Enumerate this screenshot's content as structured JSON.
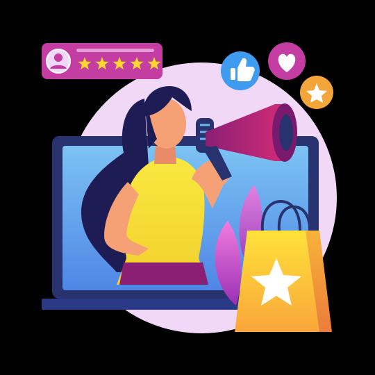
{
  "illustration": {
    "colors": {
      "background": "#000000",
      "circle": "#F1D8F6",
      "laptop_frame": "#27326F",
      "laptop_screen": "#6FB8F0",
      "rating_card": "#C43DA2",
      "star": "#FFD52E",
      "thumbs_badge": "#3E9BEF",
      "heart_badge": "#C43DA2",
      "star_badge": "#F4A53A",
      "hair": "#1E1C55",
      "skin": "#F6A076",
      "shirt": "#F7E53B",
      "megaphone": "#B0206E",
      "bag": "#FFC531",
      "leaf": "#D04FC6"
    },
    "rating": {
      "stars": 5,
      "max": 5
    },
    "icons": [
      "user-avatar-icon",
      "star-icon",
      "thumbs-up-icon",
      "heart-icon",
      "star-badge-icon",
      "megaphone-icon",
      "shopping-bag-icon"
    ]
  }
}
